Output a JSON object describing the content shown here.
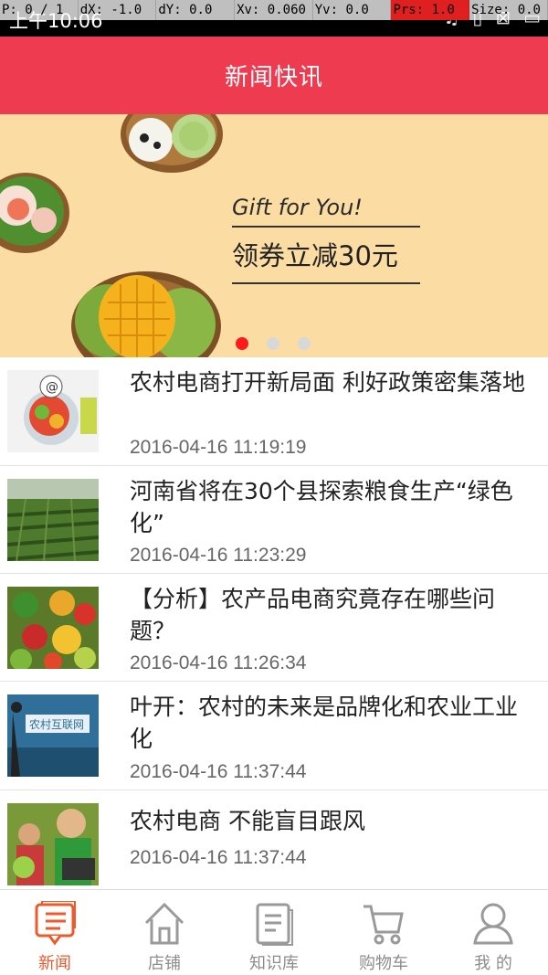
{
  "status_bar": {
    "time": "上午10:06",
    "debug": [
      "P: 0 / 1",
      "dX: -1.0",
      "dY: 0.0",
      "Xv: 0.060",
      "Yv: 0.0",
      "Prs: 1.0",
      "Size: 0.0"
    ]
  },
  "header": {
    "title": "新闻快讯"
  },
  "banner": {
    "subtitle": "Gift for You!",
    "headline": "领券立减30元",
    "slides": 3,
    "active_slide": 1
  },
  "news": [
    {
      "title": "农村电商打开新局面 利好政策密集落地",
      "date": "2016-04-16 11:19:19"
    },
    {
      "title": "河南省将在30个县探索粮食生产“绿色化”",
      "date": "2016-04-16 11:23:29"
    },
    {
      "title": "【分析】农产品电商究竟存在哪些问题？",
      "date": "2016-04-16 11:26:34"
    },
    {
      "title": "叶开：农村的未来是品牌化和农业工业化",
      "date": "2016-04-16 11:37:44"
    },
    {
      "title": "农村电商 不能盲目跟风",
      "date": "2016-04-16 11:37:44"
    }
  ],
  "tabs": [
    {
      "label": "新闻",
      "icon": "news-icon",
      "active": true
    },
    {
      "label": "店铺",
      "icon": "home-icon",
      "active": false
    },
    {
      "label": "知识库",
      "icon": "document-icon",
      "active": false
    },
    {
      "label": "购物车",
      "icon": "cart-icon",
      "active": false
    },
    {
      "label": "我 的",
      "icon": "user-icon",
      "active": false
    }
  ],
  "colors": {
    "header": "#ef3b4f",
    "banner_bg": "#fbdca3",
    "active_tab": "#ef5a2b"
  }
}
